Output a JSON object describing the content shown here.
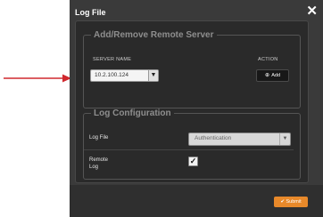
{
  "dialog": {
    "title": "Log File",
    "close_glyph": "✕"
  },
  "server_section": {
    "legend": "Add/Remove Remote Server",
    "col_server_name": "SERVER NAME",
    "col_action": "ACTION",
    "server_value": "10.2.100.124",
    "add_icon": "⊕",
    "add_label": "Add"
  },
  "log_section": {
    "legend": "Log Configuration",
    "log_file_label": "Log File",
    "log_file_value": "Authentication",
    "remote_log_label_1": "Remote",
    "remote_log_label_2": "Log",
    "remote_log_checked": true
  },
  "footer": {
    "submit_icon": "✔",
    "submit_label": "Submit"
  },
  "colors": {
    "dialog_bg": "#3a3a3a",
    "panel_bg": "#2a2a2a",
    "accent_submit": "#e8892a",
    "arrow": "#d0282e"
  }
}
